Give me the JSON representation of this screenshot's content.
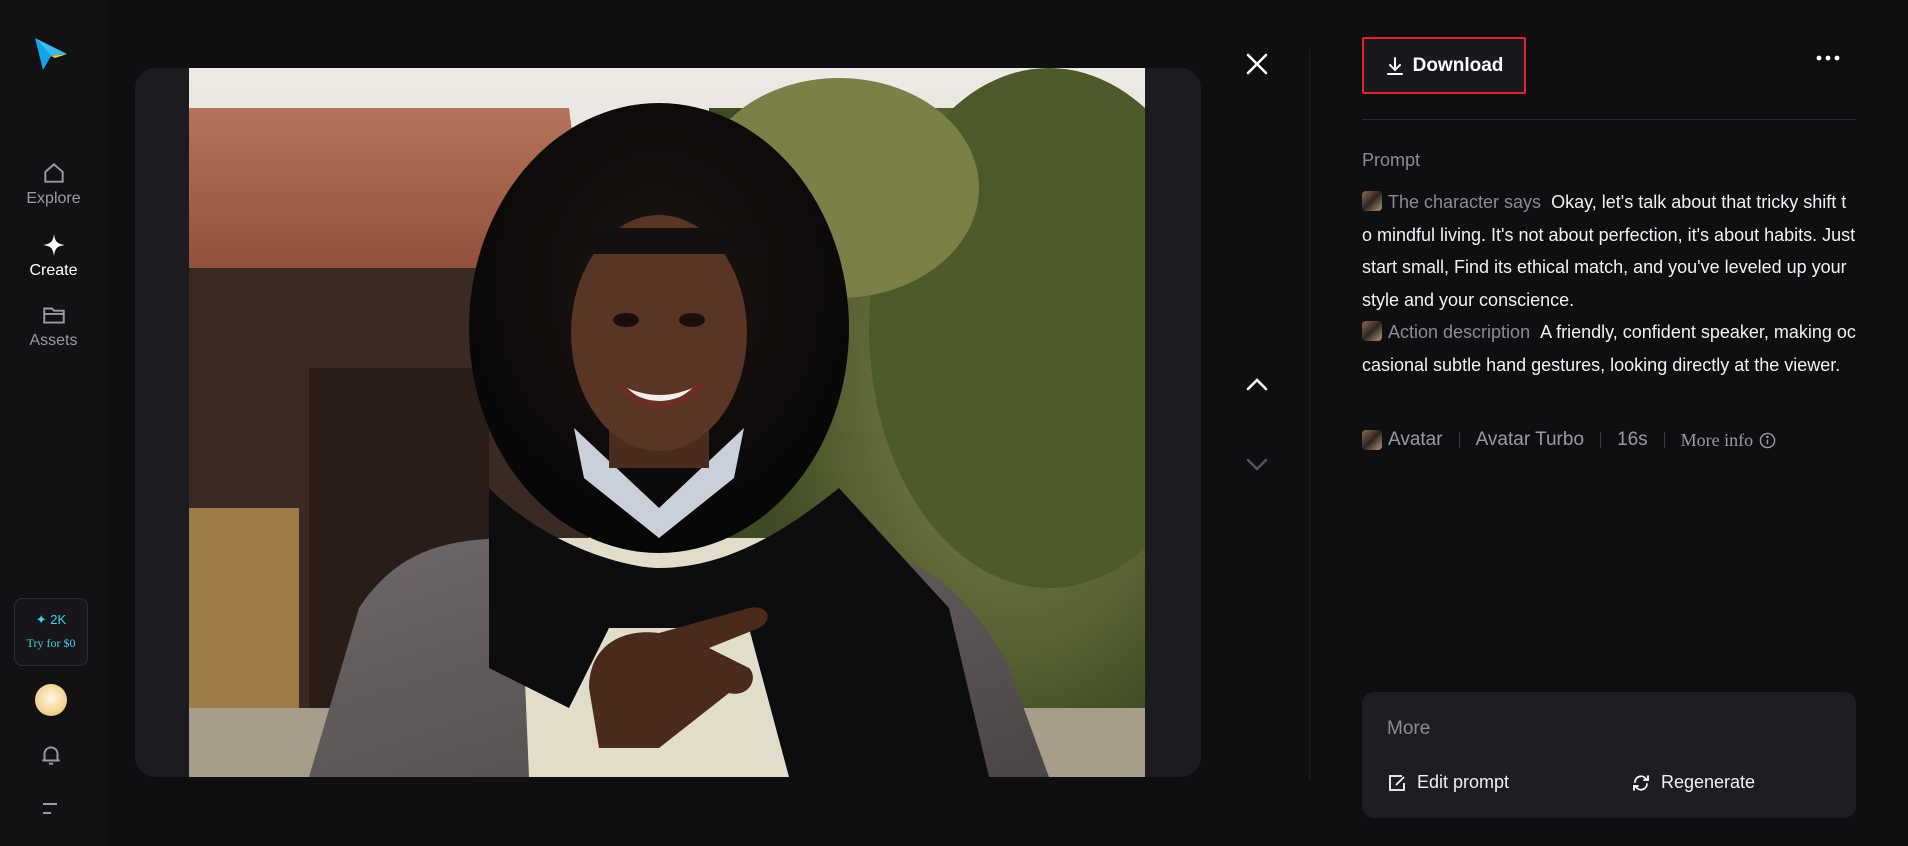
{
  "sidebar": {
    "items": [
      {
        "label": "Explore",
        "icon": "home-icon"
      },
      {
        "label": "Create",
        "icon": "sparkle-icon"
      },
      {
        "label": "Assets",
        "icon": "folder-icon"
      }
    ],
    "credits": {
      "count": "✦ 2K",
      "cta": "Try for $0"
    }
  },
  "toolbar": {
    "download_label": "Download"
  },
  "prompt": {
    "heading": "Prompt",
    "character_label": "The character says",
    "character_text": "Okay, let's talk about that tricky shift to mindful living. It's not about perfection, it's about habits. Just start small, Find its ethical match, and you've leveled up your style and your conscience.",
    "action_label": "Action description",
    "action_text": "A friendly, confident speaker, making occasional subtle hand gestures, looking directly at the viewer."
  },
  "meta": {
    "type": "Avatar",
    "model": "Avatar Turbo",
    "duration": "16s",
    "more_info": "More info"
  },
  "more": {
    "title": "More",
    "edit_label": "Edit prompt",
    "regenerate_label": "Regenerate"
  },
  "colors": {
    "accent": "#3fd0e6",
    "highlight": "#e0262c",
    "background": "#0f0f12"
  }
}
